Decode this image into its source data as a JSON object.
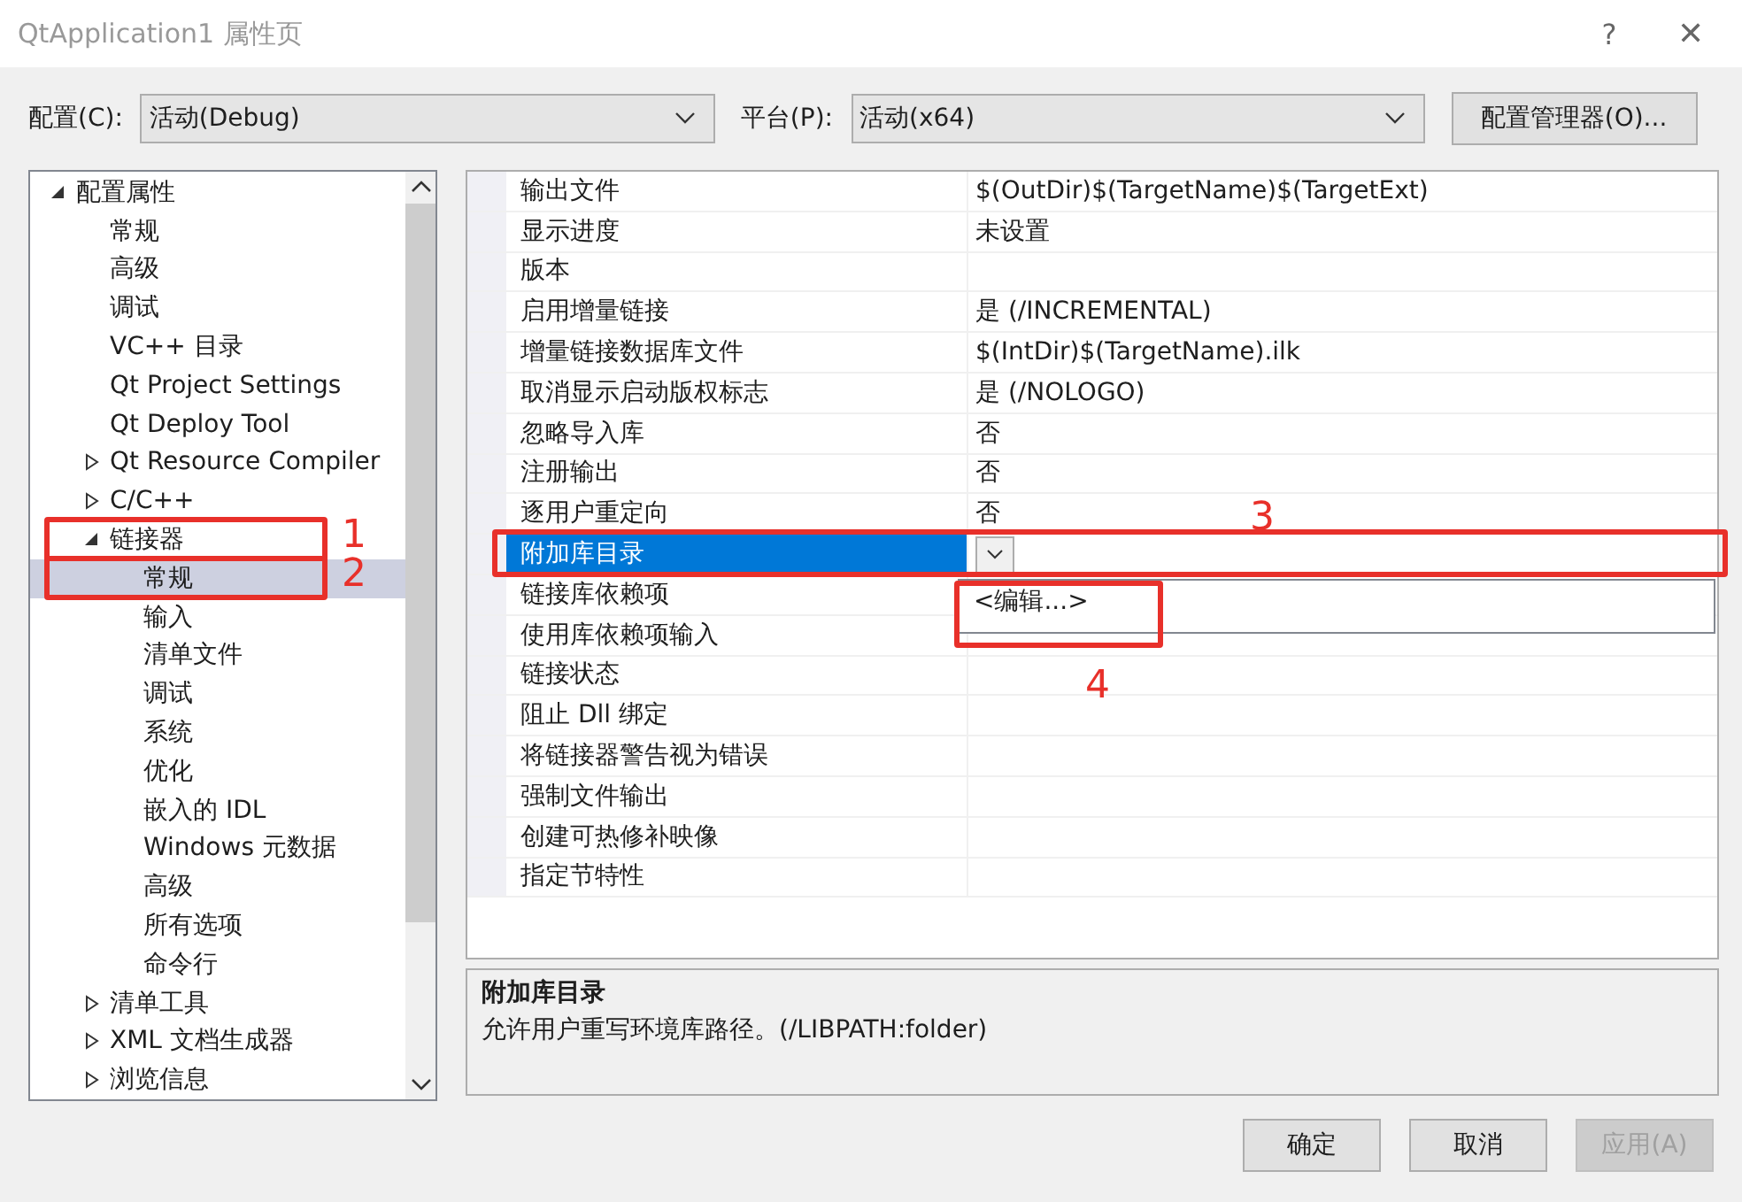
{
  "window": {
    "title": "QtApplication1 属性页",
    "help": "?",
    "close": "✕"
  },
  "toolbar": {
    "config_label": "配置(C):",
    "config_value": "活动(Debug)",
    "platform_label": "平台(P):",
    "platform_value": "活动(x64)",
    "manager_button": "配置管理器(O)..."
  },
  "tree": [
    {
      "label": "配置属性",
      "expanded": true,
      "selected": false,
      "children": [
        {
          "label": "常规",
          "selected": false
        },
        {
          "label": "高级",
          "selected": false
        },
        {
          "label": "调试",
          "selected": false
        },
        {
          "label": "VC++ 目录",
          "selected": false
        },
        {
          "label": "Qt Project Settings",
          "selected": false
        },
        {
          "label": "Qt Deploy Tool",
          "selected": false
        },
        {
          "label": "Qt Resource Compiler",
          "expanded": false,
          "selected": false
        },
        {
          "label": "C/C++",
          "expanded": false,
          "selected": false
        },
        {
          "label": "链接器",
          "expanded": true,
          "selected": false,
          "annotation": "1",
          "children": [
            {
              "label": "常规",
              "selected": true,
              "annotation": "2"
            },
            {
              "label": "输入",
              "selected": false
            },
            {
              "label": "清单文件",
              "selected": false
            },
            {
              "label": "调试",
              "selected": false
            },
            {
              "label": "系统",
              "selected": false
            },
            {
              "label": "优化",
              "selected": false
            },
            {
              "label": "嵌入的 IDL",
              "selected": false
            },
            {
              "label": "Windows 元数据",
              "selected": false
            },
            {
              "label": "高级",
              "selected": false
            },
            {
              "label": "所有选项",
              "selected": false
            },
            {
              "label": "命令行",
              "selected": false
            }
          ]
        },
        {
          "label": "清单工具",
          "expanded": false,
          "selected": false
        },
        {
          "label": "XML 文档生成器",
          "expanded": false,
          "selected": false
        },
        {
          "label": "浏览信息",
          "expanded": false,
          "selected": false
        }
      ]
    }
  ],
  "properties": [
    {
      "name": "输出文件",
      "value": "$(OutDir)$(TargetName)$(TargetExt)",
      "selected": false
    },
    {
      "name": "显示进度",
      "value": "未设置",
      "selected": false
    },
    {
      "name": "版本",
      "selected": false
    },
    {
      "name": "启用增量链接",
      "value": "是 (/INCREMENTAL)",
      "selected": false
    },
    {
      "name": "增量链接数据库文件",
      "value": "$(IntDir)$(TargetName).ilk",
      "selected": false
    },
    {
      "name": "取消显示启动版权标志",
      "value": "是 (/NOLOGO)",
      "selected": false
    },
    {
      "name": "忽略导入库",
      "value": "否",
      "selected": false
    },
    {
      "name": "注册输出",
      "value": "否",
      "selected": false
    },
    {
      "name": "逐用户重定向",
      "value": "否",
      "selected": false
    },
    {
      "name": "附加库目录",
      "selected": true,
      "annotation": "3",
      "dropdown": {
        "item": "<编辑...>",
        "annotation": "4"
      }
    },
    {
      "name": "链接库依赖项",
      "selected": false
    },
    {
      "name": "使用库依赖项输入",
      "selected": false
    },
    {
      "name": "链接状态",
      "selected": false
    },
    {
      "name": "阻止 Dll 绑定",
      "selected": false
    },
    {
      "name": "将链接器警告视为错误",
      "selected": false
    },
    {
      "name": "强制文件输出",
      "selected": false
    },
    {
      "name": "创建可热修补映像",
      "selected": false
    },
    {
      "name": "指定节特性",
      "selected": false
    }
  ],
  "description": {
    "title": "附加库目录",
    "text": "允许用户重写环境库路径。(/LIBPATH:folder)"
  },
  "buttons": [
    {
      "label": "确定",
      "disabled": false
    },
    {
      "label": "取消",
      "disabled": false
    },
    {
      "label": "应用(A)",
      "disabled": true
    }
  ]
}
